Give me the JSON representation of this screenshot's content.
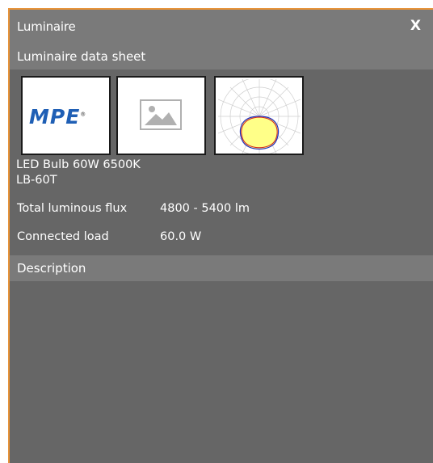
{
  "window": {
    "title": "Luminaire",
    "close_label": "X"
  },
  "data_sheet": {
    "header": "Luminaire data sheet",
    "brand_logo_text": "MPE",
    "product_name": "LED Bulb 60W 6500K",
    "product_code": "LB-60T",
    "total_flux_label": "Total luminous flux",
    "total_flux_value": "4800 - 5400 lm",
    "connected_load_label": "Connected load",
    "connected_load_value": "60.0 W"
  },
  "description": {
    "header": "Description"
  },
  "colors": {
    "accent": "#e8943a",
    "panel": "#666666",
    "header": "#7a7a7a",
    "brand": "#1f5fb5"
  },
  "icons": [
    "close-icon",
    "image-placeholder-icon",
    "polar-diagram"
  ]
}
